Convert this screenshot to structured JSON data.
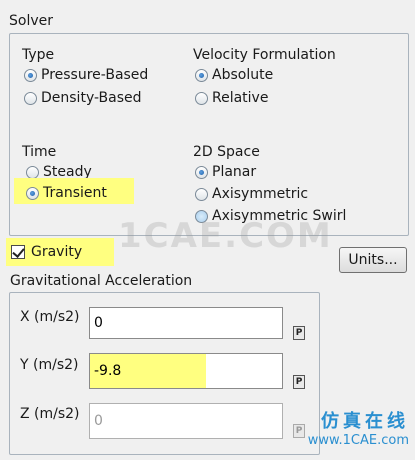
{
  "solver": {
    "title": "Solver",
    "type": {
      "label": "Type",
      "options": [
        "Pressure-Based",
        "Density-Based"
      ],
      "selected": "Pressure-Based"
    },
    "velocity": {
      "label": "Velocity Formulation",
      "options": [
        "Absolute",
        "Relative"
      ],
      "selected": "Absolute"
    },
    "time": {
      "label": "Time",
      "options": [
        "Steady",
        "Transient"
      ],
      "selected": "Transient"
    },
    "space": {
      "label": "2D Space",
      "options": [
        "Planar",
        "Axisymmetric",
        "Axisymmetric Swirl"
      ],
      "selected": "Planar"
    }
  },
  "gravity": {
    "label": "Gravity",
    "checked": true,
    "units_button": "Units...",
    "group_title": "Gravitational Acceleration",
    "x": {
      "label": "X (m/s2)",
      "value": "0"
    },
    "y": {
      "label": "Y (m/s2)",
      "value": "-9.8"
    },
    "z": {
      "label": "Z (m/s2)",
      "value": "0"
    },
    "p_button": "P"
  },
  "watermark": {
    "text": "1CAE.COM",
    "brand_cn": "仿真在线",
    "brand_url": "www.1CAE.com"
  },
  "colors": {
    "highlight": "#ffff80",
    "radio_selected": "#1d5fa8",
    "group_border": "#a9b3bd"
  }
}
